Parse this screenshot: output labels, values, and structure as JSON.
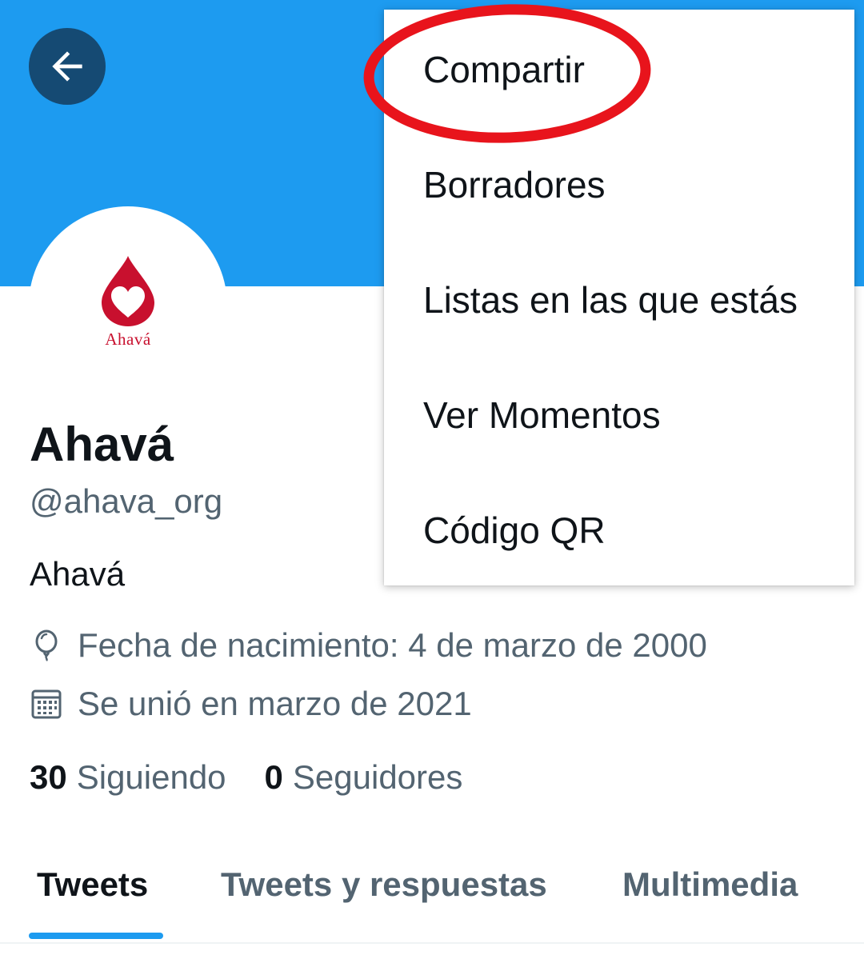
{
  "profile": {
    "name": "Ahavá",
    "handle": "@ahava_org",
    "bio": "Ahavá",
    "birth_date": "Fecha de nacimiento: 4 de marzo de 2000",
    "joined": "Se unió en marzo de 2021",
    "avatar_text": "Ahavá"
  },
  "stats": {
    "following_count": "30",
    "following_label": "Siguiendo",
    "followers_count": "0",
    "followers_label": "Seguidores"
  },
  "tabs": [
    {
      "label": "Tweets",
      "active": true
    },
    {
      "label": "Tweets y respuestas",
      "active": false
    },
    {
      "label": "Multimedia",
      "active": false
    }
  ],
  "menu": {
    "items": [
      {
        "label": "Compartir"
      },
      {
        "label": "Borradores"
      },
      {
        "label": "Listas en las que estás"
      },
      {
        "label": "Ver Momentos"
      },
      {
        "label": "Código QR"
      }
    ],
    "highlighted_item": "Compartir"
  },
  "icons": {
    "back": "arrow-left-icon",
    "birth": "balloon-icon",
    "joined": "calendar-icon",
    "avatar": "blood-drop-heart-logo"
  },
  "colors": {
    "banner": "#1d9bf0",
    "back_button": "#154a73",
    "accent": "#1d9bf0",
    "highlight_ring": "#e8141c",
    "logo_red": "#c8102e",
    "secondary_text": "#536471"
  }
}
